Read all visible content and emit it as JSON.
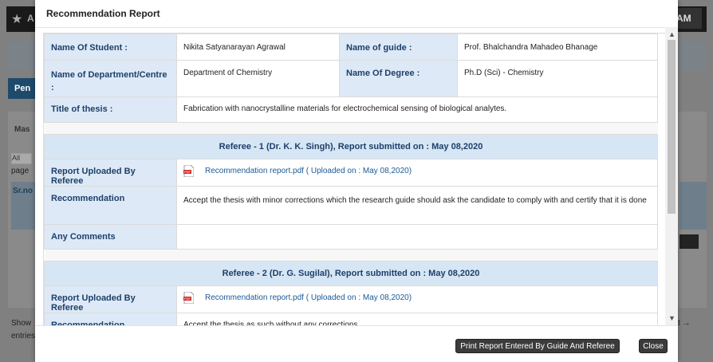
{
  "background": {
    "header_a": "A",
    "header_am": "AM",
    "pending_tab": "Pen",
    "master_tab": "Mas",
    "all_select": "All",
    "page_label": "page",
    "srno_header": "Sr.no",
    "show_label": "Show",
    "entries_label": "entries",
    "next_label": "t →"
  },
  "modal": {
    "title": "Recommendation Report",
    "student_label": "Name Of Student :",
    "student_value": "Nikita Satyanarayan Agrawal",
    "guide_label": "Name of guide :",
    "guide_value": "Prof. Bhalchandra Mahadeo Bhanage",
    "department_label": "Name of Department/Centre :",
    "department_value": "Department of Chemistry",
    "degree_label": "Name Of Degree :",
    "degree_value": "Ph.D (Sci) - Chemistry",
    "thesis_label": "Title of thesis :",
    "thesis_value": "Fabrication with nanocrystalline materials for electrochemical sensing of biological analytes.",
    "referees": [
      {
        "heading": "Referee - 1 (Dr. K. K. Singh), Report submitted on : May 08,2020",
        "report_label": "Report Uploaded By Referee",
        "report_link": "Recommendation report.pdf ( Uploaded on : May 08,2020)",
        "recommendation_label": "Recommendation",
        "recommendation_value": "Accept the thesis with minor corrections which the research guide should ask the candidate to comply with and certify that it is done",
        "comments_label": "Any Comments",
        "comments_value": ""
      },
      {
        "heading": "Referee - 2 (Dr. G. Sugilal), Report submitted on : May 08,2020",
        "report_label": "Report Uploaded By Referee",
        "report_link": "Recommendation report.pdf ( Uploaded on : May 08,2020)",
        "recommendation_label": "Recommendation",
        "recommendation_value": "Accept the thesis as such without any corrections"
      }
    ],
    "print_button": "Print Report Entered By Guide And Referee",
    "close_button": "Close"
  },
  "icons": {
    "pdf": "pdf-icon",
    "star": "star-icon"
  },
  "colors": {
    "label_bg": "#dde9f6",
    "label_text": "#1e3f6a",
    "link": "#1a5a96",
    "button": "#3b3b3b"
  }
}
